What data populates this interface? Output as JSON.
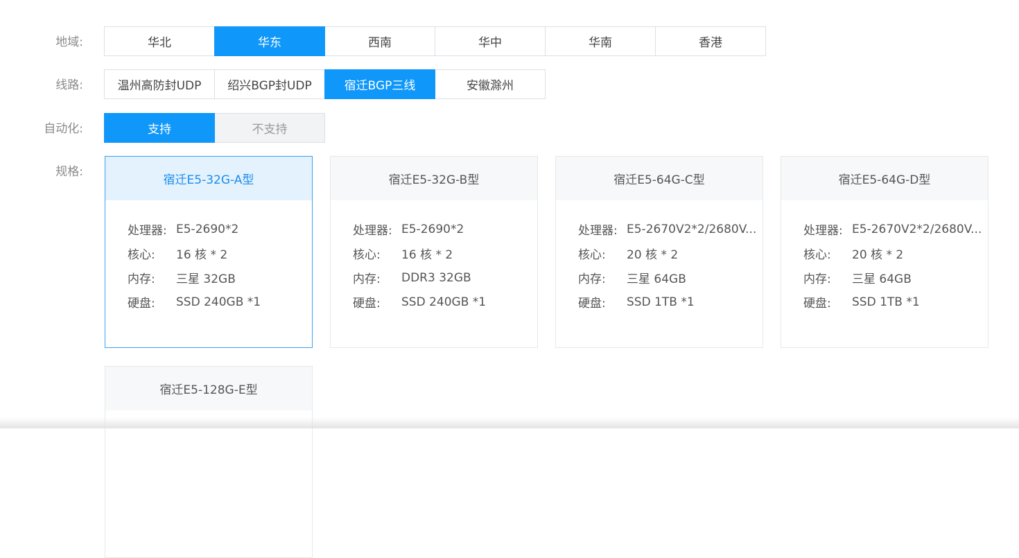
{
  "region": {
    "label": "地域:",
    "options": [
      "华北",
      "华东",
      "西南",
      "华中",
      "华南",
      "香港"
    ],
    "selected": "华东"
  },
  "line": {
    "label": "线路:",
    "options": [
      "温州高防封UDP",
      "绍兴BGP封UDP",
      "宿迁BGP三线",
      "安徽滁州"
    ],
    "selected": "宿迁BGP三线"
  },
  "automation": {
    "label": "自动化:",
    "options": [
      "支持",
      "不支持"
    ],
    "selected": "支持"
  },
  "spec": {
    "label": "规格:",
    "keys": {
      "cpu": "处理器:",
      "cores": "核心:",
      "memory": "内存:",
      "disk": "硬盘:"
    },
    "cards": [
      {
        "title": "宿迁E5-32G-A型",
        "cpu": "E5-2690*2",
        "cores": "16 核 * 2",
        "memory": "三星 32GB",
        "disk": "SSD 240GB *1",
        "selected": true
      },
      {
        "title": "宿迁E5-32G-B型",
        "cpu": "E5-2690*2",
        "cores": "16 核 * 2",
        "memory": "DDR3 32GB",
        "disk": "SSD 240GB *1",
        "selected": false
      },
      {
        "title": "宿迁E5-64G-C型",
        "cpu": "E5-2670V2*2/2680V...",
        "cores": "20 核 * 2",
        "memory": "三星 64GB",
        "disk": "SSD 1TB *1",
        "selected": false
      },
      {
        "title": "宿迁E5-64G-D型",
        "cpu": "E5-2670V2*2/2680V...",
        "cores": "20 核 * 2",
        "memory": "三星 64GB",
        "disk": "SSD 1TB *1",
        "selected": false
      },
      {
        "title": "宿迁E5-128G-E型",
        "selected": false
      }
    ]
  },
  "colors": {
    "accent": "#0f97fa",
    "selected_card_border": "#3d9ff0",
    "selected_card_head": "#e3f2fd"
  }
}
